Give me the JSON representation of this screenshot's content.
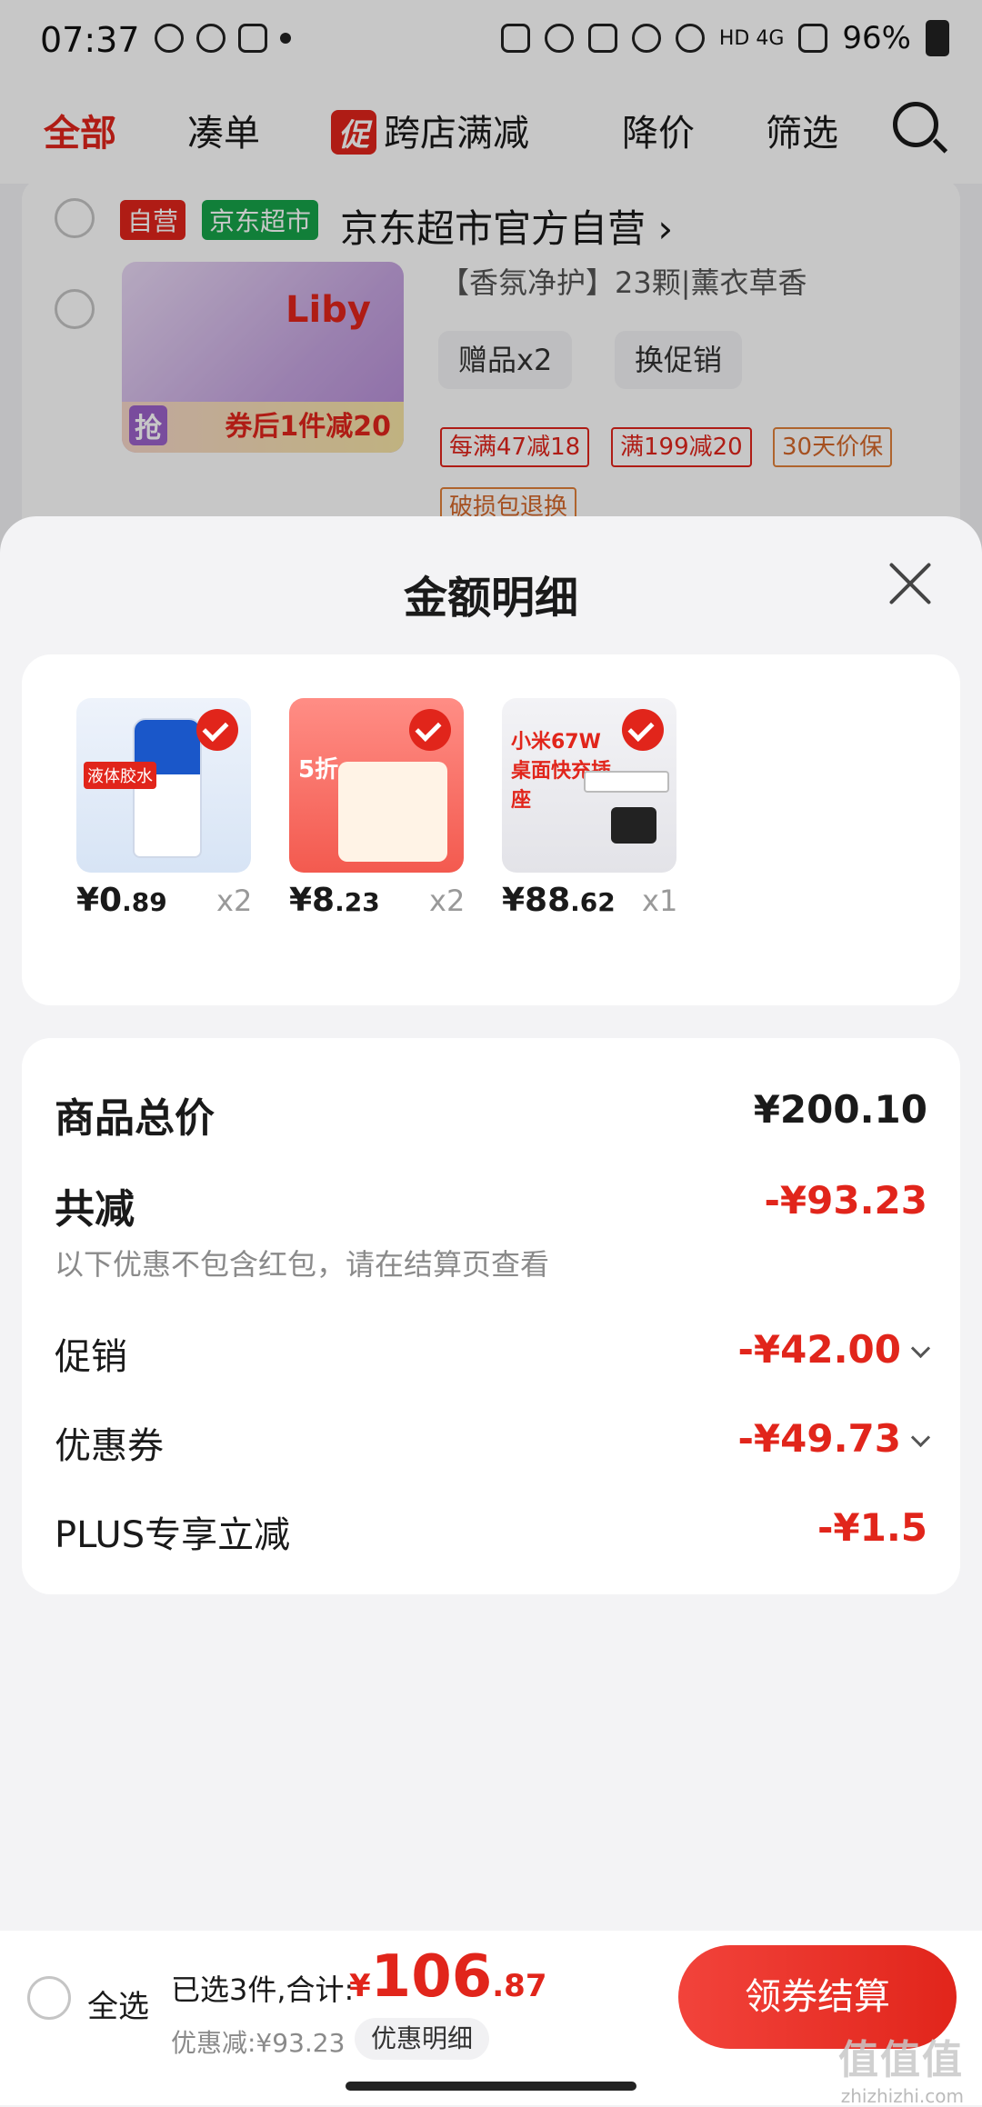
{
  "status_bar": {
    "time": "07:37",
    "network": "HD 4G",
    "battery": "96%",
    "icons": [
      "chat-icon",
      "brightness-icon",
      "gallery-icon",
      "dot-icon",
      "memo-icon",
      "alarm-icon",
      "mute-icon",
      "location-icon",
      "wifi-icon",
      "signal-icon",
      "battery-icon"
    ]
  },
  "top_tabs": {
    "all": "全部",
    "combine": "凑单",
    "promo_mark": "促",
    "cross_store": "跨店满减",
    "price_drop": "降价",
    "filter": "筛选"
  },
  "shop": {
    "tag_self": "自营",
    "tag_market": "京东超市",
    "name": "京东超市官方自营",
    "product": {
      "image_brand": "Liby",
      "image_grab": "抢",
      "image_coupon": "券后1件减20",
      "sku": "【香氛净护】23颗|薰衣草香",
      "gift_pill": "赠品x2",
      "promo_pill": "换促销",
      "tags": [
        "每满47减18",
        "满199减20",
        "30天价保",
        "破损包退换"
      ]
    }
  },
  "sheet": {
    "title": "金额明细",
    "items": [
      {
        "price_int": "¥0",
        "price_dec": ".89",
        "qty": "x2",
        "thumb_label": "液体胶水"
      },
      {
        "price_int": "¥8",
        "price_dec": ".23",
        "qty": "x2",
        "thumb_label": "5折"
      },
      {
        "price_int": "¥88",
        "price_dec": ".62",
        "qty": "x1",
        "thumb_label": "小米67W桌面快充插座"
      }
    ],
    "summary": {
      "total_label": "商品总价",
      "total_value": "¥200.10",
      "reduce_label": "共减",
      "reduce_value": "-¥93.23",
      "note": "以下优惠不包含红包，请在结算页查看",
      "promo_label": "促销",
      "promo_value": "-¥42.00",
      "coupon_label": "优惠券",
      "coupon_value": "-¥49.73",
      "plus_label": "PLUS专享立减",
      "plus_value": "-¥1.5"
    }
  },
  "bottom_bar": {
    "select_all": "全选",
    "selected_text": "已选3件,合计:",
    "total_yen": "¥",
    "total_int": "106",
    "total_dec": ".87",
    "discount_text": "优惠减:¥93.23",
    "detail_button": "优惠明细",
    "checkout_button": "领券结算"
  },
  "watermark": {
    "logo": "值值值",
    "url": "zhizhizhi.com"
  },
  "colors": {
    "accent_red": "#e1251b",
    "green_tag": "#16a34a",
    "sheet_bg": "#f3f3f5"
  }
}
